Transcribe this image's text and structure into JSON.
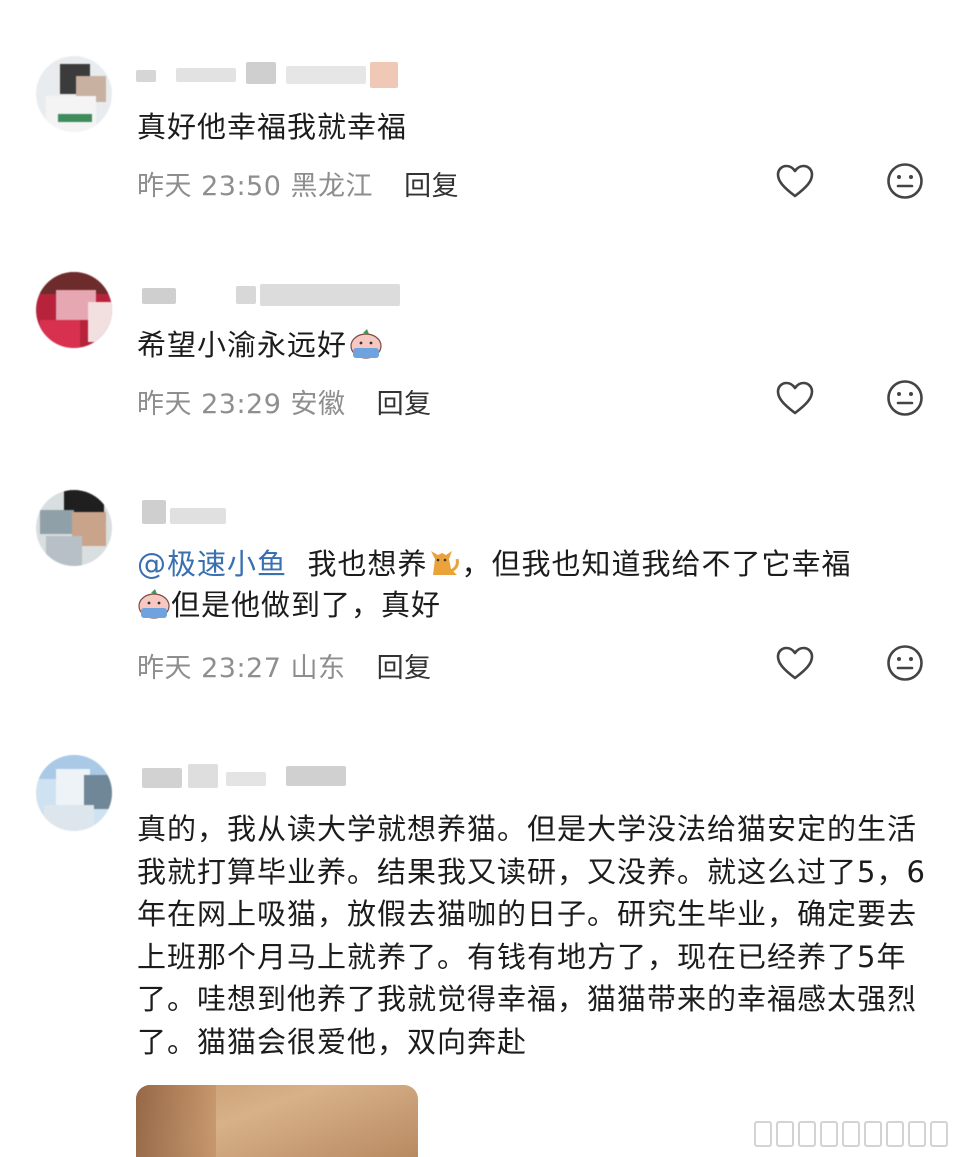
{
  "comments": [
    {
      "text": "真好他幸福我就幸福",
      "time": "昨天 23:50",
      "location": "黑龙江",
      "reply_label": "回复"
    },
    {
      "text": "希望小渝永远好",
      "time": "昨天 23:29",
      "location": "安徽",
      "reply_label": "回复"
    },
    {
      "mention": "@极速小鱼",
      "text_part1": "我也想养",
      "text_part2": "，但我也知道我给不了它幸福",
      "text_part3": "但是他做到了，真好",
      "time": "昨天 23:27",
      "location": "山东",
      "reply_label": "回复"
    },
    {
      "text": "真的，我从读大学就想养猫。但是大学没法给猫安定的生活我就打算毕业养。结果我又读研，又没养。就这么过了5，6年在网上吸猫，放假去猫咖的日子。研究生毕业，确定要去上班那个月马上就养了。有钱有地方了，现在已经养了5年了。哇想到他养了我就觉得幸福，猫猫带来的幸福感太强烈了。猫猫会很爱他，双向奔赴"
    }
  ],
  "icons": {
    "like": "heart-outline-icon",
    "react": "neutral-face-icon"
  },
  "colors": {
    "mention": "#3a6fb0",
    "meta": "#8e8e8e",
    "text": "#1c1c1c"
  }
}
